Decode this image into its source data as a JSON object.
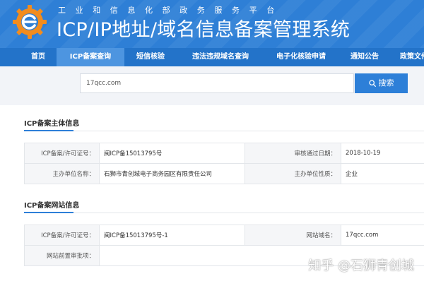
{
  "header": {
    "subtitle": "工业和信息化部政务服务平台",
    "title": "ICP/IP地址/域名信息备案管理系统",
    "logo_icon": "gear-e-logo-icon",
    "colors": {
      "header_bg": "#2e7fd6",
      "nav_bg": "#2373c9",
      "nav_active": "#4d95e0",
      "logo_orange": "#f28c1e"
    }
  },
  "nav": {
    "items": [
      {
        "label": "首页"
      },
      {
        "label": "ICP备案查询",
        "active": true
      },
      {
        "label": "短信核验"
      },
      {
        "label": "违法违规域名查询"
      },
      {
        "label": "电子化核验申请"
      },
      {
        "label": "通知公告"
      },
      {
        "label": "政策文件"
      }
    ]
  },
  "search": {
    "value": "17qcc.com",
    "button_label": "搜索",
    "button_icon": "search-icon"
  },
  "entity_section": {
    "title": "ICP备案主体信息",
    "rows": [
      {
        "label1": "ICP备案/许可证号：",
        "value1": "闽ICP备15013795号",
        "label2": "审核通过日期：",
        "value2": "2018-10-19"
      },
      {
        "label1": "主办单位名称：",
        "value1": "石狮市青创城电子商务园区有限责任公司",
        "label2": "主办单位性质：",
        "value2": "企业"
      }
    ]
  },
  "site_section": {
    "title": "ICP备案网站信息",
    "rows": [
      {
        "label1": "ICP备案/许可证号：",
        "value1": "闽ICP备15013795号-1",
        "label2": "网站域名：",
        "value2": "17qcc.com"
      },
      {
        "label1": "网站前置审批项：",
        "value1": "",
        "label2": "",
        "value2": ""
      }
    ]
  },
  "watermark": "知乎 @石狮青创城"
}
